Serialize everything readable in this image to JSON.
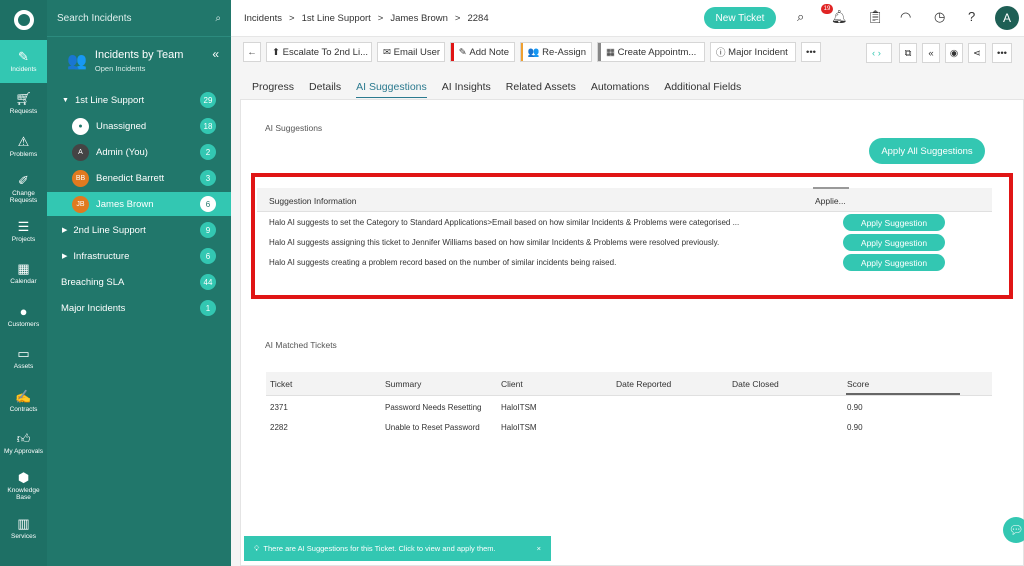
{
  "nav": {
    "items": [
      {
        "label": "Incidents",
        "icon": "tag-icon"
      },
      {
        "label": "Requests",
        "icon": "cart-icon"
      },
      {
        "label": "Problems",
        "icon": "warning-icon"
      },
      {
        "label": "Change Requests",
        "icon": "edit-icon"
      },
      {
        "label": "Projects",
        "icon": "projects-icon"
      },
      {
        "label": "Calendar",
        "icon": "calendar-icon"
      },
      {
        "label": "Customers",
        "icon": "customer-icon"
      },
      {
        "label": "Assets",
        "icon": "monitor-icon"
      },
      {
        "label": "Contracts",
        "icon": "contract-icon"
      },
      {
        "label": "My Approvals",
        "icon": "thumbs-up-icon"
      },
      {
        "label": "Knowledge Base",
        "icon": "cube-icon"
      },
      {
        "label": "Services",
        "icon": "book-icon"
      }
    ]
  },
  "sidebar": {
    "search_placeholder": "Search Incidents",
    "title": "Incidents by Team",
    "subtitle": "Open Incidents",
    "rows": [
      {
        "label": "1st Line Support",
        "count": "29"
      },
      {
        "label": "Unassigned",
        "count": "18"
      },
      {
        "label": "Admin (You)",
        "count": "2",
        "initials": "A"
      },
      {
        "label": "Benedict Barrett",
        "count": "3",
        "initials": "BB"
      },
      {
        "label": "James Brown",
        "count": "6",
        "initials": "JB"
      },
      {
        "label": "2nd Line Support",
        "count": "9"
      },
      {
        "label": "Infrastructure",
        "count": "6"
      },
      {
        "label": "Breaching SLA",
        "count": "44"
      },
      {
        "label": "Major Incidents",
        "count": "1"
      }
    ]
  },
  "header": {
    "breadcrumb": [
      "Incidents",
      ">",
      "1st Line Support",
      ">",
      "James Brown",
      ">",
      "2284"
    ],
    "new_ticket": "New Ticket",
    "notification_count": "19",
    "avatar": "A"
  },
  "toolbar": {
    "escalate": "Escalate To 2nd Li...",
    "email": "Email User",
    "note": "Add Note",
    "reassign": "Re-Assign",
    "appointment": "Create Appointm...",
    "major": "Major Incident",
    "more": "•••"
  },
  "tabs": [
    "Progress",
    "Details",
    "AI Suggestions",
    "AI Insights",
    "Related Assets",
    "Automations",
    "Additional Fields"
  ],
  "ai": {
    "section_title": "AI Suggestions",
    "apply_all": "Apply All Suggestions",
    "col_info": "Suggestion Information",
    "col_apply": "Applie...",
    "apply_label": "Apply Suggestion",
    "rows": [
      "Halo AI suggests to set the Category to Standard Applications>Email based on how similar Incidents & Problems were categorised ...",
      "Halo AI suggests assigning this ticket to Jennifer Williams based on how similar Incidents & Problems were resolved previously.",
      "Halo AI suggests creating a problem record based on the number of similar incidents being raised."
    ]
  },
  "matched": {
    "section_title": "AI Matched Tickets",
    "headers": [
      "Ticket",
      "Summary",
      "Client",
      "Date Reported",
      "Date Closed",
      "Score"
    ],
    "rows": [
      [
        "2371",
        "Password Needs Resetting",
        "HaloITSM",
        "",
        "",
        "0.90"
      ],
      [
        "2282",
        "Unable to Reset Password",
        "HaloITSM",
        "",
        "",
        "0.90"
      ]
    ]
  },
  "toast": {
    "text": "There are AI Suggestions for this Ticket. Click to view and apply them.",
    "close": "×"
  },
  "colors": {
    "teal": "#33c7b2",
    "dark_teal": "#21776b",
    "highlight": "#e01515"
  }
}
